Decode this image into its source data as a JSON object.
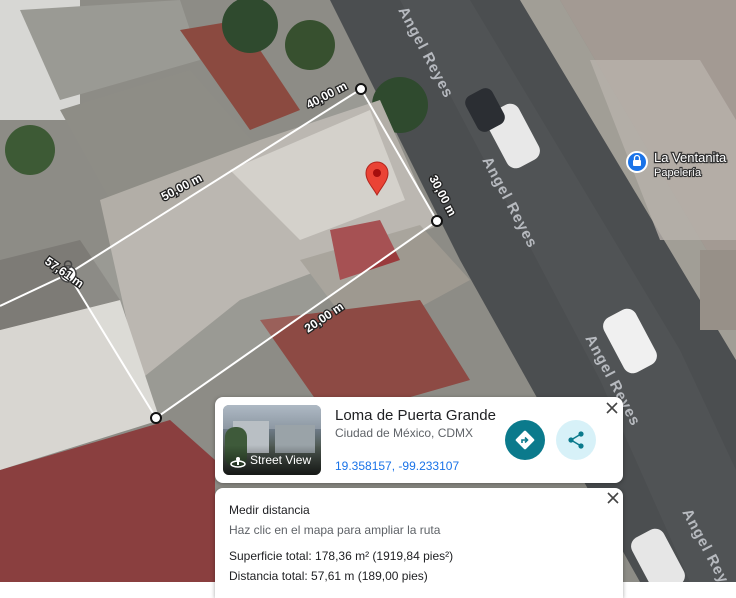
{
  "map": {
    "street_labels": [
      "Angel Reyes",
      "Angel Reyes",
      "Angel Reyes",
      "Angel Reyes",
      "Angel Reyes"
    ],
    "measure_labels": [
      "40,00 m",
      "50,00 m",
      "30,00 m",
      "57,61 m",
      "20,00 m"
    ],
    "poi": {
      "name": "La Ventanita",
      "category": "Papelería",
      "icon": "shopping-bag-icon",
      "color": "#1a73e8"
    },
    "pin_color": "#ea4335"
  },
  "place_card": {
    "street_view_label": "Street View",
    "title": "Loma de Puerta Grande",
    "subtitle": "Ciudad de México, CDMX",
    "coordinates": "19.358157, -99.233107",
    "directions_icon": "directions-icon",
    "share_icon": "share-icon",
    "accent": "#0b7a8c"
  },
  "measure": {
    "title": "Medir distancia",
    "hint": "Haz clic en el mapa para ampliar la ruta",
    "area": "Superficie total: 178,36 m² (1919,84 pies²)",
    "distance": "Distancia total: 57,61 m (189,00 pies)"
  }
}
